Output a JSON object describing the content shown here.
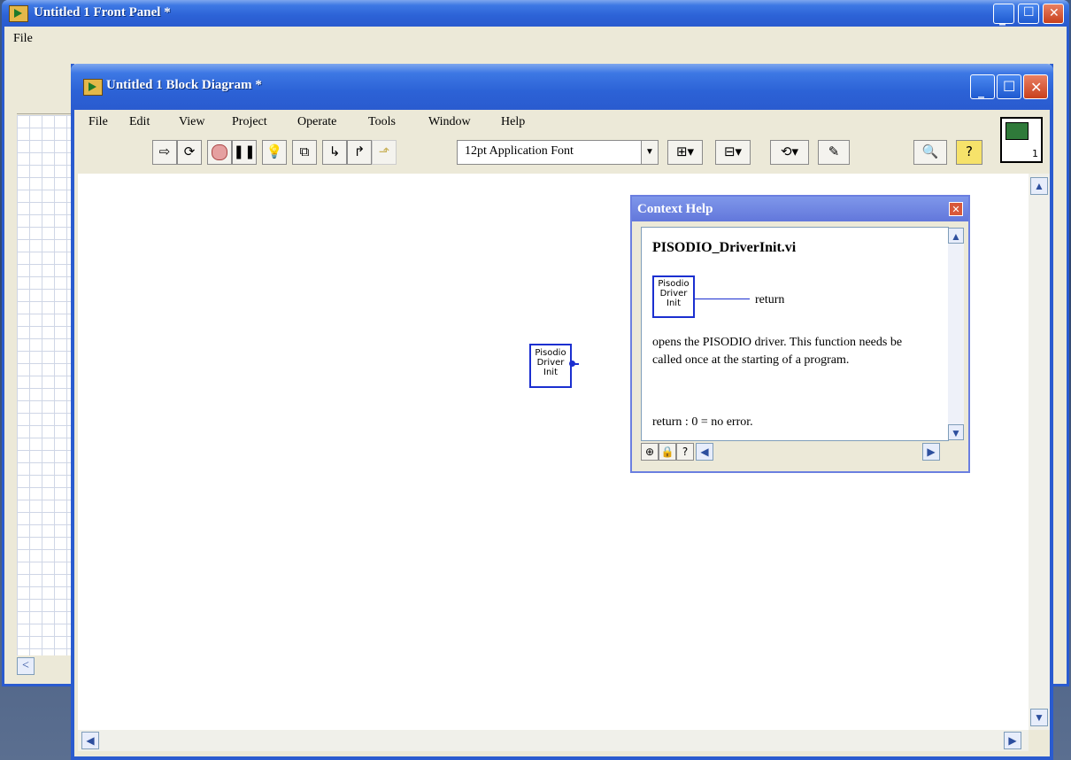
{
  "front_panel": {
    "title": "Untitled 1 Front Panel *",
    "menu_first": "File"
  },
  "block_diagram": {
    "title": "Untitled 1 Block Diagram *",
    "menu": [
      "File",
      "Edit",
      "View",
      "Project",
      "Operate",
      "Tools",
      "Window",
      "Help"
    ],
    "font_selector": "12pt Application Font",
    "node": {
      "line1": "Pisodio",
      "line2": "Driver",
      "line3": "Init"
    }
  },
  "context_help": {
    "title": "Context Help",
    "vi_name": "PISODIO_DriverInit.vi",
    "icon_lines": [
      "Pisodio",
      "Driver",
      "Init"
    ],
    "terminal_label": "return",
    "description": "opens the PISODIO driver. This function needs be called once at the starting of a program.",
    "return_desc": "return : 0 = no error."
  },
  "connector_pane_number": "1",
  "icons": [
    "run-arrow-icon",
    "run-continuously-icon",
    "abort-icon",
    "pause-icon",
    "highlight-execution-icon",
    "retain-wire-values-icon",
    "step-into-icon",
    "step-over-icon",
    "step-out-icon",
    "align-objects-icon",
    "distribute-objects-icon",
    "reorder-icon",
    "cleanup-diagram-icon",
    "search-icon",
    "context-help-icon"
  ]
}
